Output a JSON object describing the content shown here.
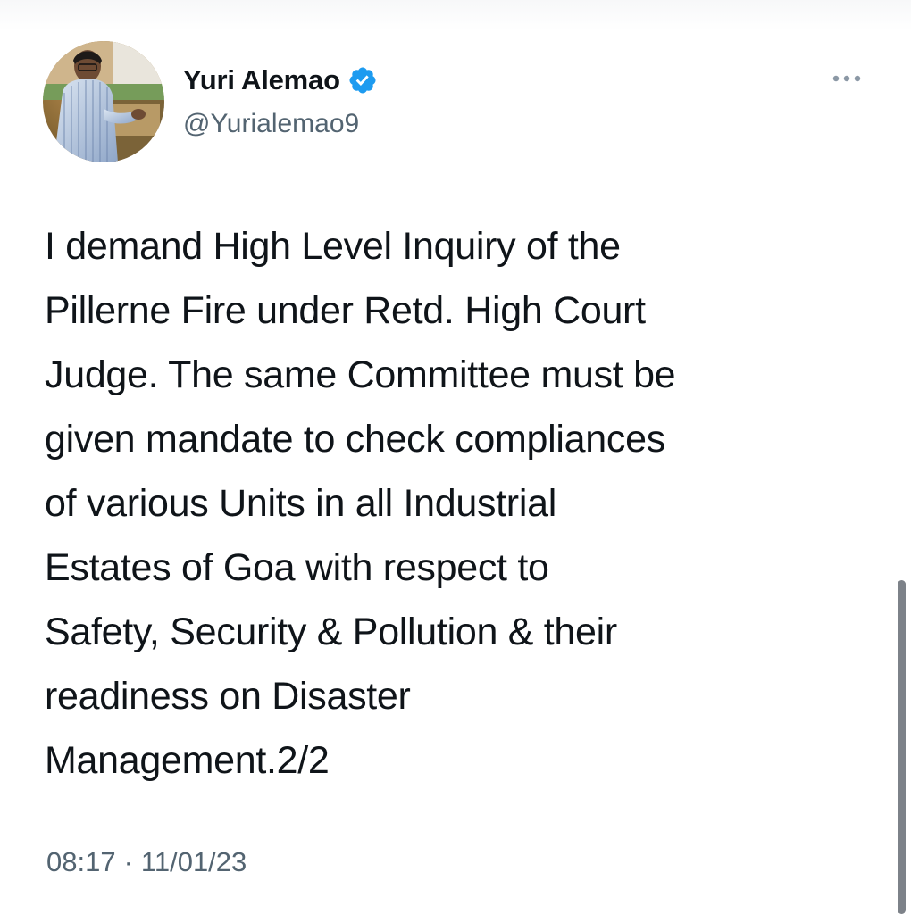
{
  "tweet": {
    "author": {
      "display_name": "Yuri Alemao",
      "handle": "@Yurialemao9",
      "verified_icon": "verified-badge-icon",
      "avatar": "profile-photo"
    },
    "text": "I demand High Level Inquiry of the\nPillerne Fire under Retd. High Court\nJudge. The same Committee must be\ngiven mandate to check compliances\nof various Units in all Industrial\nEstates of Goa with respect to\nSafety, Security & Pollution & their\nreadiness on Disaster\nManagement.2/2",
    "time": "08:17",
    "separator": "·",
    "date": "11/01/23"
  },
  "controls": {
    "more_icon": "more-options-icon"
  },
  "colors": {
    "text": "#0f1419",
    "muted": "#536471",
    "verified": "#1d9bf0",
    "scrollbar": "#7d8289"
  }
}
